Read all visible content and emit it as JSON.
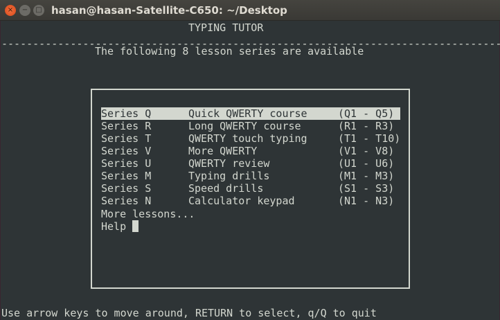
{
  "window": {
    "title": "hasan@hasan-Satellite-C650: ~/Desktop",
    "close_icon": "×",
    "minimize_icon": "−",
    "maximize_icon": "□"
  },
  "header": {
    "title": "TYPING TUTOR",
    "divider": "--------------------------------------------------------------------------------",
    "subtitle": "The following 8 lesson series are available"
  },
  "menu": {
    "items": [
      {
        "series": "Series Q",
        "name": "Quick QWERTY course",
        "range": "(Q1 - Q5)",
        "selected": true
      },
      {
        "series": "Series R",
        "name": "Long QWERTY course",
        "range": "(R1 - R3)"
      },
      {
        "series": "Series T",
        "name": "QWERTY touch typing",
        "range": "(T1 - T10)"
      },
      {
        "series": "Series V",
        "name": "More QWERTY",
        "range": "(V1 - V8)"
      },
      {
        "series": "Series U",
        "name": "QWERTY review",
        "range": "(U1 - U6)"
      },
      {
        "series": "Series M",
        "name": "Typing drills",
        "range": "(M1 - M3)"
      },
      {
        "series": "Series S",
        "name": "Speed drills",
        "range": "(S1 - S3)"
      },
      {
        "series": "Series N",
        "name": "Calculator keypad",
        "range": "(N1 - N3)"
      }
    ],
    "more": "More lessons...",
    "help": "Help"
  },
  "footer": {
    "hint": "Use arrow keys to move around, RETURN to select, q/Q to quit"
  },
  "colors": {
    "background": "#2e3436",
    "foreground": "#d3d7cf"
  }
}
